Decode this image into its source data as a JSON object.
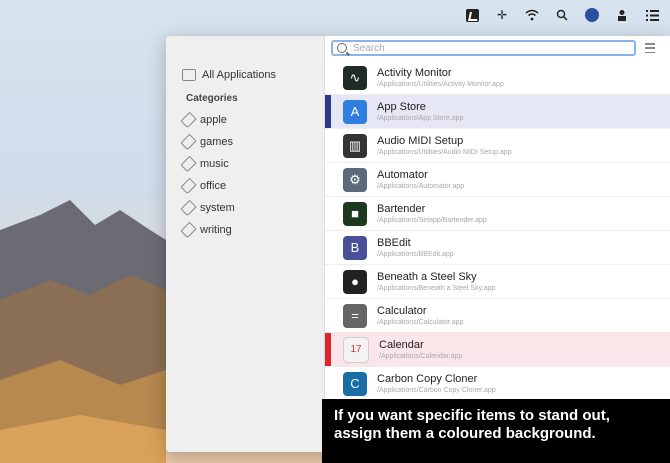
{
  "menubar": {
    "icons": [
      "app-icon",
      "cross-icon",
      "wifi-icon",
      "search-icon",
      "safari-icon",
      "user-icon",
      "list-icon"
    ]
  },
  "sidebar": {
    "all_label": "All Applications",
    "categories_heading": "Categories",
    "tags": [
      "apple",
      "games",
      "music",
      "office",
      "system",
      "writing"
    ]
  },
  "search": {
    "placeholder": "Search"
  },
  "apps": [
    {
      "name": "Activity Monitor",
      "path": "/Applications/Utilities/Activity Monitor.app",
      "icon": "activity-monitor-icon",
      "highlight": ""
    },
    {
      "name": "App Store",
      "path": "/Applications/App Store.app",
      "icon": "app-store-icon",
      "highlight": "#2d3a8c"
    },
    {
      "name": "Audio MIDI Setup",
      "path": "/Applications/Utilities/Audio MIDI Setup.app",
      "icon": "audio-midi-icon",
      "highlight": ""
    },
    {
      "name": "Automator",
      "path": "/Applications/Automator.app",
      "icon": "automator-icon",
      "highlight": ""
    },
    {
      "name": "Bartender",
      "path": "/Applications/Setapp/Bartender.app",
      "icon": "bartender-icon",
      "highlight": ""
    },
    {
      "name": "BBEdit",
      "path": "/Applications/BBEdit.app",
      "icon": "bbedit-icon",
      "highlight": ""
    },
    {
      "name": "Beneath a Steel Sky",
      "path": "/Applications/Beneath a Steel Sky.app",
      "icon": "steel-sky-icon",
      "highlight": ""
    },
    {
      "name": "Calculator",
      "path": "/Applications/Calculator.app",
      "icon": "calculator-icon",
      "highlight": ""
    },
    {
      "name": "Calendar",
      "path": "/Applications/Calendar.app",
      "icon": "calendar-icon",
      "highlight": "#e0242f"
    },
    {
      "name": "Carbon Copy Cloner",
      "path": "/Applications/Carbon Copy Cloner.app",
      "icon": "ccc-icon",
      "highlight": ""
    }
  ],
  "caption": {
    "line1": "If you want specific items to stand out,",
    "line2": "assign them a coloured background."
  }
}
